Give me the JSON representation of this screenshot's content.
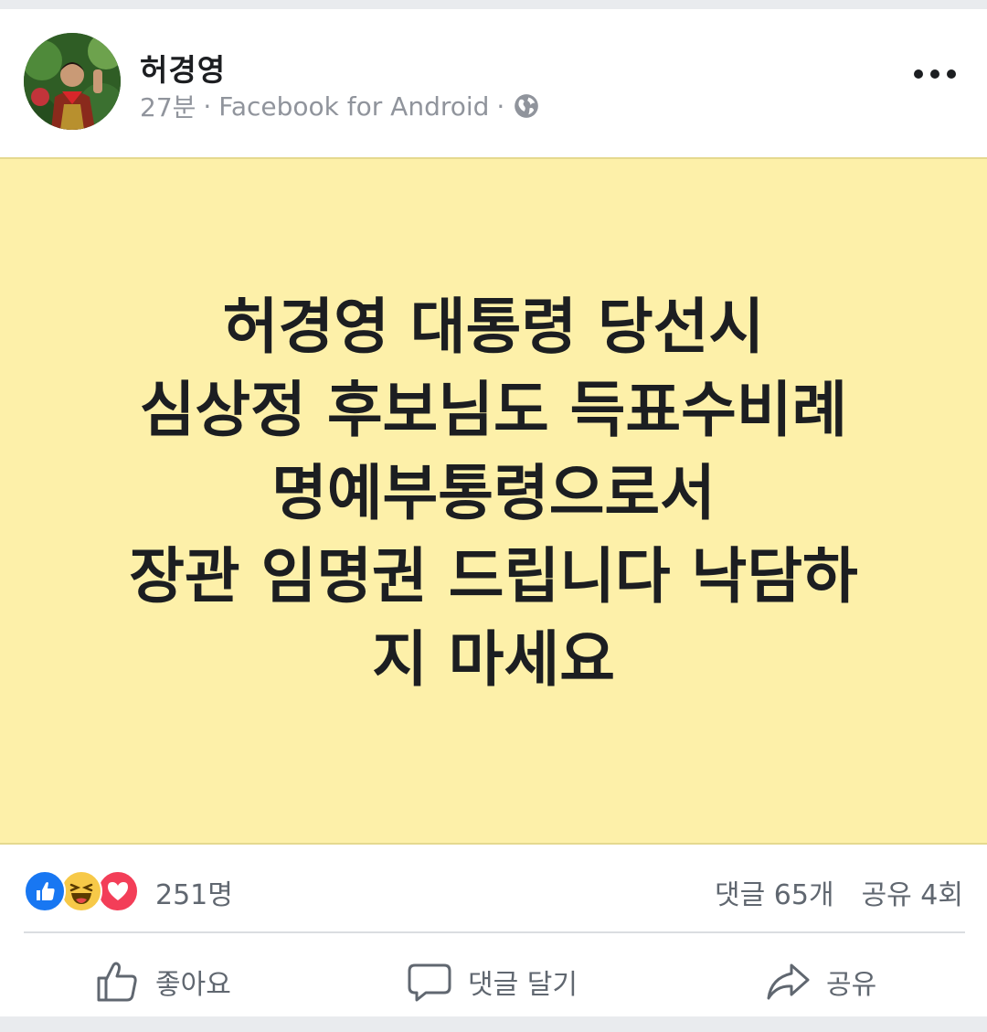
{
  "post": {
    "author": "허경영",
    "time": "27분",
    "source": "Facebook for Android",
    "meta_separator": "·",
    "body_lines": [
      "허경영 대통령 당선시",
      "심상정 후보님도 득표수비례",
      "명예부통령으로서",
      "장관 임명권 드립니다 낙담하",
      "지 마세요"
    ],
    "background_color": "#fdf0a9"
  },
  "stats": {
    "reaction_count": "251명",
    "comments": "댓글 65개",
    "shares": "공유 4회",
    "reaction_icons": [
      "like-icon",
      "haha-icon",
      "love-icon"
    ]
  },
  "actions": {
    "like": "좋아요",
    "comment": "댓글 달기",
    "share": "공유"
  },
  "colors": {
    "like_blue": "#1877f2",
    "haha_yellow": "#f7c948",
    "love_red": "#f33e58"
  }
}
